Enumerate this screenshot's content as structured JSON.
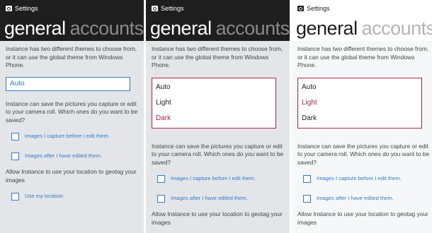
{
  "panels": [
    {
      "app_title": "Settings",
      "pivot": {
        "active": "general",
        "inactive": "accounts"
      },
      "theme_description": "Instance has two different themes to choose from, or it can use the global theme from Windows Phone.",
      "theme_selected": "Auto",
      "save_description": "Instance can save the pictures you capture or edit to your camera roll.  Which ones do you want to be saved?",
      "checkboxes": [
        "Images I capture before I edit them.",
        "Images after I have edited them."
      ],
      "location_description": "Allow Instance to use your location to geotag your images",
      "location_checkbox": "Use my location"
    },
    {
      "app_title": "Settings",
      "pivot": {
        "active": "general",
        "inactive": "accounts"
      },
      "theme_description": "Instance has two different themes to choose from, or it can use the global theme from Windows Phone.",
      "theme_options": [
        "Auto",
        "Light",
        "Dark"
      ],
      "theme_selected": "Dark",
      "save_description": "Instance can save the pictures you capture or edit to your camera roll.  Which ones do you want to be saved?",
      "checkboxes": [
        "Images I capture before I edit them.",
        "Images after I have edited them."
      ],
      "location_description": "Allow Instance to use your location to geotag your images"
    },
    {
      "app_title": "Settings",
      "pivot": {
        "active": "general",
        "inactive": "accounts"
      },
      "theme_description": "Instance has two different themes to choose from, or it can use the global theme from Windows Phone.",
      "theme_options": [
        "Auto",
        "Light",
        "Dark"
      ],
      "theme_selected": "Light",
      "save_description": "Instance can save the pictures you capture or edit to your camera roll.  Which ones do you want to be saved?",
      "checkboxes": [
        "Images I capture before I edit them.",
        "Images after I have edited them."
      ],
      "location_description": "Allow Instance to use your location to geotag your images"
    }
  ],
  "colors": {
    "accent_blue": "#2f7dcf",
    "accent_red": "#b0283f",
    "header_dark": "#1e1e1e"
  }
}
